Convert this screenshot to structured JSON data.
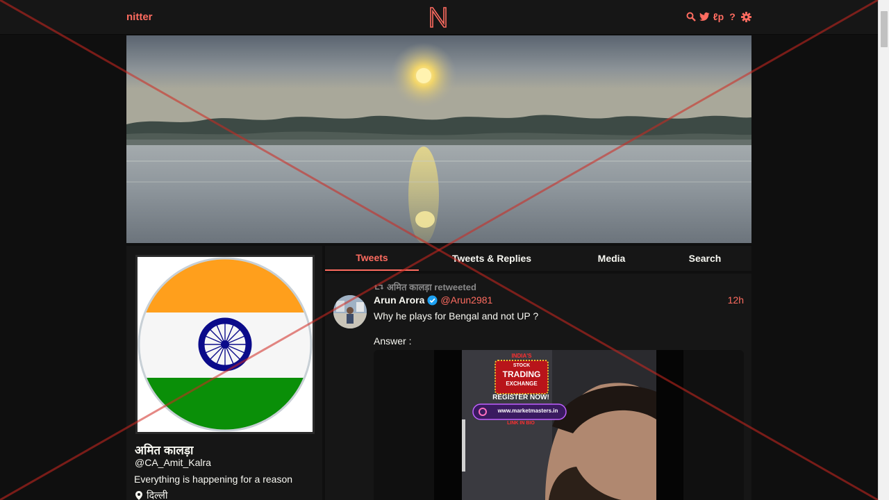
{
  "navbar": {
    "brand": "nitter",
    "logo_letter": "N",
    "icons": [
      "search-icon",
      "twitter-bird-icon",
      "rss-icon",
      "help-icon",
      "gear-icon"
    ],
    "rss_label": "ℓp",
    "help_label": "?"
  },
  "profile": {
    "fullname": "अमित कालड़ा",
    "username": "@CA_Amit_Kalra",
    "bio": "Everything is happening for a reason",
    "location": "दिल्ली",
    "avatar": "indian-flag-avatar"
  },
  "tabs": [
    {
      "label": "Tweets",
      "active": true
    },
    {
      "label": "Tweets & Replies",
      "active": false
    },
    {
      "label": "Media",
      "active": false
    },
    {
      "label": "Search",
      "active": false
    }
  ],
  "tweet": {
    "retweet_header": "अमित कालड़ा retweeted",
    "author_name": "Arun Arora",
    "verified": true,
    "author_handle": "@Arun2981",
    "date": "12h",
    "text_line1": "Why he plays for Bengal and not UP ?",
    "text_line2": "Answer :",
    "media": {
      "ad_line1": "INDIA'S",
      "ad_line2": "STOCK",
      "ad_line3": "TRADING",
      "ad_line4": "EXCHANGE",
      "ad_line5": "REGISTER NOW!",
      "ad_url": "www.marketmasters.in",
      "ad_line6": "LINK IN BIO"
    }
  },
  "colors": {
    "accent": "#ff6c60",
    "background": "#0f0f0f",
    "panel": "#161616",
    "flag_saffron": "#ff9f1c",
    "flag_green": "#0a8f08",
    "chakra": "#0b0b8a",
    "overlay_red": "#c0302a"
  }
}
